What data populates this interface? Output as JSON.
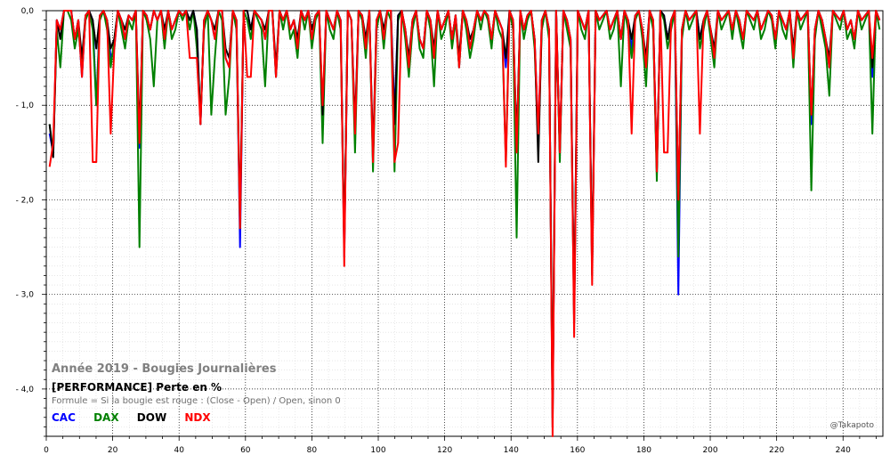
{
  "chart_data": {
    "type": "line",
    "title": "Année 2019 - Bougies Journalières",
    "subtitle": "[PERFORMANCE] Perte en %",
    "formula": "Formule = Si la bougie est rouge : (Close - Open) / Open, sinon 0",
    "credit": "@Takapoto",
    "xlim": [
      0,
      252
    ],
    "ylim": [
      -4.5,
      0
    ],
    "x_ticks": [
      "0",
      "20",
      "40",
      "60",
      "80",
      "100",
      "120",
      "140",
      "160",
      "180",
      "200",
      "220",
      "240"
    ],
    "y_ticks": [
      {
        "value": 0,
        "label": "0,0"
      },
      {
        "value": -1,
        "label": "- 1,0"
      },
      {
        "value": -2,
        "label": "- 2,0"
      },
      {
        "value": -3,
        "label": "- 3,0"
      },
      {
        "value": -4,
        "label": "- 4,0"
      }
    ],
    "grid": true,
    "legend_position": "bottom-left",
    "series": [
      {
        "name": "CAC",
        "color": "#0000ff",
        "values": [
          -1.3,
          -1.5,
          -0.1,
          -0.2,
          0,
          0,
          0,
          -0.3,
          -0.1,
          -0.7,
          -0.05,
          0,
          -0.1,
          -1.0,
          -0.05,
          0,
          -0.1,
          -0.5,
          -0.4,
          0,
          -0.1,
          -0.3,
          -0.05,
          -0.1,
          0,
          -1.45,
          0,
          -0.05,
          -0.2,
          0,
          -0.1,
          0,
          -0.3,
          0,
          -0.2,
          -0.1,
          0,
          -0.05,
          0,
          -0.1,
          0,
          -0.2,
          -1.2,
          -0.1,
          0,
          -0.1,
          -0.3,
          0,
          0,
          -0.5,
          -0.6,
          0,
          -0.1,
          -2.5,
          0,
          0,
          -0.2,
          0,
          -0.05,
          -0.1,
          -0.3,
          0,
          0,
          -0.7,
          0,
          -0.1,
          0,
          -0.2,
          -0.1,
          -0.4,
          0,
          -0.1,
          0,
          -0.3,
          -0.05,
          0,
          -1.1,
          0,
          -0.1,
          -0.2,
          0,
          -0.1,
          -2.6,
          0,
          -0.1,
          -1.3,
          0,
          -0.05,
          -0.4,
          0,
          -1.6,
          -0.1,
          0,
          -0.3,
          0,
          0,
          -1.1,
          -0.05,
          0,
          -0.2,
          -0.6,
          -0.1,
          0,
          -0.3,
          -0.4,
          0,
          -0.1,
          -0.5,
          0,
          -0.2,
          -0.1,
          0,
          -0.3,
          -0.05,
          -0.6,
          0,
          -0.1,
          -0.4,
          -0.2,
          0,
          -0.1,
          0,
          -0.05,
          -0.3,
          0,
          -0.1,
          -0.2,
          -0.6,
          0,
          -0.1,
          -1.5,
          0,
          -0.2,
          -0.05,
          0,
          -0.3,
          -1.3,
          -0.1,
          0,
          -0.2,
          -4.3,
          0,
          -1.5,
          0,
          -0.1,
          -0.3,
          -3.3,
          0,
          -0.1,
          -0.2,
          0,
          -2.8,
          0,
          -0.1,
          -0.05,
          0,
          -0.2,
          -0.1,
          0,
          -0.3,
          0,
          -0.1,
          -0.4,
          -0.05,
          0,
          -0.2,
          -0.6,
          0,
          -0.1,
          -1.7,
          0,
          -0.05,
          -0.3,
          -0.1,
          0,
          -3.0,
          -0.2,
          0,
          -0.1,
          -0.05,
          0,
          -0.3,
          -0.1,
          0,
          -0.2,
          -0.5,
          0,
          -0.1,
          -0.05,
          0,
          -0.2,
          0,
          -0.1,
          -0.3,
          0,
          -0.05,
          -0.1,
          0,
          -0.2,
          -0.1,
          0,
          -0.05,
          -0.3,
          0,
          -0.1,
          -0.2,
          0,
          -0.5,
          0,
          -0.1,
          -0.05,
          0,
          -1.2,
          -0.2,
          0,
          -0.1,
          -0.3,
          -0.6,
          0,
          -0.05,
          -0.1,
          0,
          -0.2,
          -0.1,
          -0.3,
          0,
          -0.1,
          -0.05,
          0,
          -0.7,
          0,
          -0.1
        ]
      },
      {
        "name": "DAX",
        "color": "#008000",
        "values": [
          -1.2,
          -1.5,
          -0.2,
          -0.6,
          0,
          0,
          -0.1,
          -0.4,
          -0.2,
          -0.6,
          -0.1,
          0,
          -0.2,
          -1.0,
          -0.1,
          0,
          -0.2,
          -0.6,
          -0.3,
          0,
          -0.2,
          -0.4,
          -0.1,
          -0.2,
          0,
          -2.5,
          0,
          -0.1,
          -0.3,
          -0.8,
          -0.1,
          0,
          -0.4,
          0,
          -0.3,
          -0.2,
          0,
          -0.1,
          0,
          -0.2,
          0,
          -0.4,
          -1.1,
          -0.2,
          0,
          -1.1,
          -0.5,
          0,
          -0.1,
          -1.1,
          -0.7,
          0,
          -0.2,
          -2.3,
          0,
          -0.1,
          -0.3,
          0,
          -0.1,
          -0.2,
          -0.8,
          0,
          0,
          -0.7,
          0,
          -0.2,
          0,
          -0.3,
          -0.2,
          -0.5,
          0,
          -0.2,
          0,
          -0.4,
          -0.1,
          0,
          -1.4,
          0,
          -0.2,
          -0.3,
          0,
          -0.2,
          -2.5,
          0,
          -0.1,
          -1.5,
          0,
          -0.1,
          -0.5,
          0,
          -1.7,
          -0.2,
          0,
          -0.4,
          0,
          -0.1,
          -1.7,
          -0.1,
          0,
          -0.3,
          -0.7,
          -0.2,
          0,
          -0.4,
          -0.5,
          0,
          -0.2,
          -0.8,
          0,
          -0.3,
          -0.2,
          0,
          -0.4,
          -0.1,
          -0.6,
          0,
          -0.2,
          -0.5,
          -0.3,
          0,
          -0.2,
          0,
          -0.1,
          -0.4,
          0,
          -0.2,
          -0.3,
          -1.6,
          0,
          -0.2,
          -2.4,
          0,
          -0.3,
          -0.1,
          0,
          -0.4,
          -1.4,
          -0.2,
          0,
          -0.3,
          -4.2,
          0,
          -1.6,
          0,
          -0.2,
          -0.4,
          -3.3,
          0,
          -0.2,
          -0.3,
          0,
          -2.8,
          0,
          -0.2,
          -0.1,
          0,
          -0.3,
          -0.2,
          0,
          -0.8,
          0,
          -0.2,
          -0.5,
          -0.1,
          0,
          -0.3,
          -0.8,
          0,
          -0.2,
          -1.8,
          0,
          -0.1,
          -0.4,
          -0.2,
          0,
          -2.6,
          -0.3,
          0,
          -0.2,
          -0.1,
          0,
          -0.4,
          -0.2,
          0,
          -0.3,
          -0.6,
          0,
          -0.2,
          -0.1,
          0,
          -0.3,
          0,
          -0.2,
          -0.4,
          0,
          -0.1,
          -0.2,
          0,
          -0.3,
          -0.2,
          0,
          -0.1,
          -0.4,
          0,
          -0.2,
          -0.3,
          0,
          -0.6,
          0,
          -0.2,
          -0.1,
          0,
          -1.9,
          -0.3,
          0,
          -0.2,
          -0.4,
          -0.9,
          0,
          -0.1,
          -0.2,
          0,
          -0.3,
          -0.2,
          -0.4,
          0,
          -0.2,
          -0.1,
          0,
          -1.3,
          0,
          -0.2
        ]
      },
      {
        "name": "DOW",
        "color": "#000000",
        "values": [
          -1.2,
          -1.55,
          -0.1,
          -0.3,
          0,
          0,
          0,
          -0.3,
          -0.1,
          -0.5,
          -0.05,
          0,
          -0.1,
          -0.4,
          -0.05,
          0,
          -0.1,
          -0.4,
          -0.3,
          0,
          -0.1,
          -0.2,
          -0.05,
          -0.1,
          0,
          -1.3,
          0,
          -0.05,
          -0.2,
          0,
          -0.1,
          0,
          -0.2,
          0,
          -0.2,
          -0.1,
          0,
          -0.05,
          0,
          -0.1,
          0,
          -0.2,
          -1.2,
          -0.1,
          0,
          -0.1,
          -0.2,
          0,
          0,
          -0.4,
          -0.5,
          0,
          -0.1,
          -2.2,
          0,
          0,
          -0.2,
          0,
          -0.05,
          -0.1,
          -0.2,
          0,
          0,
          -0.6,
          0,
          -0.1,
          0,
          -0.2,
          -0.1,
          -0.3,
          0,
          -0.1,
          0,
          -0.2,
          -0.05,
          0,
          -1.1,
          0,
          -0.1,
          -0.2,
          0,
          -0.1,
          -2.5,
          0,
          -0.1,
          -1.2,
          0,
          -0.05,
          -0.3,
          0,
          -1.5,
          -0.1,
          0,
          -0.2,
          0,
          0,
          -1.2,
          -0.05,
          0,
          -0.2,
          -0.5,
          -0.1,
          0,
          -0.3,
          -0.4,
          0,
          -0.1,
          -0.4,
          0,
          -0.2,
          -0.1,
          0,
          -0.3,
          -0.05,
          -0.5,
          0,
          -0.1,
          -0.3,
          -0.2,
          0,
          -0.1,
          0,
          -0.05,
          -0.3,
          0,
          -0.1,
          -0.2,
          -0.5,
          0,
          -0.1,
          -1.4,
          0,
          -0.2,
          -0.05,
          0,
          -0.3,
          -1.6,
          -0.1,
          0,
          -0.2,
          -4.4,
          0,
          -1.5,
          0,
          -0.1,
          -0.3,
          -3.2,
          0,
          -0.1,
          -0.2,
          0,
          -2.7,
          0,
          -0.1,
          -0.05,
          0,
          -0.2,
          -0.1,
          0,
          -0.3,
          0,
          -0.1,
          -0.3,
          -0.05,
          0,
          -0.2,
          -0.5,
          0,
          -0.1,
          -1.7,
          0,
          -0.05,
          -0.3,
          -0.1,
          0,
          -2.0,
          -0.2,
          0,
          -0.1,
          -0.05,
          0,
          -0.3,
          -0.1,
          0,
          -0.2,
          -0.4,
          0,
          -0.1,
          -0.05,
          0,
          -0.2,
          0,
          -0.1,
          -0.3,
          0,
          -0.05,
          -0.1,
          0,
          -0.2,
          -0.1,
          0,
          -0.05,
          -0.3,
          0,
          -0.1,
          -0.2,
          0,
          -0.4,
          0,
          -0.1,
          -0.05,
          0,
          -1.1,
          -0.2,
          0,
          -0.1,
          -0.3,
          -0.5,
          0,
          -0.05,
          -0.1,
          0,
          -0.2,
          -0.1,
          -0.3,
          0,
          -0.1,
          -0.05,
          0,
          -0.6,
          0,
          -0.1
        ]
      },
      {
        "name": "NDX",
        "color": "#ff0000",
        "values": [
          -1.65,
          -1.4,
          -0.1,
          -0.2,
          0,
          0,
          0,
          -0.3,
          -0.1,
          -0.7,
          -0.05,
          0,
          -1.6,
          -1.6,
          -0.05,
          0,
          -0.1,
          -1.3,
          -0.4,
          0,
          -0.1,
          -0.3,
          -0.05,
          -0.1,
          0,
          -1.4,
          0,
          -0.05,
          -0.2,
          0,
          -0.1,
          0,
          -0.3,
          0,
          -0.2,
          -0.1,
          0,
          -0.05,
          0,
          -0.5,
          -0.5,
          -0.5,
          -1.2,
          -0.1,
          0,
          -0.1,
          -0.3,
          0,
          0,
          -0.5,
          -0.6,
          0,
          -0.1,
          -2.3,
          0,
          -0.7,
          -0.7,
          0,
          -0.05,
          -0.1,
          -0.3,
          0,
          0,
          -0.7,
          0,
          -0.1,
          0,
          -0.2,
          -0.1,
          -0.4,
          0,
          -0.1,
          0,
          -0.3,
          -0.05,
          0,
          -1.0,
          0,
          -0.1,
          -0.2,
          0,
          -0.1,
          -2.7,
          0,
          -0.1,
          -1.3,
          0,
          -0.05,
          -0.4,
          0,
          -1.6,
          -0.1,
          0,
          -0.3,
          0,
          0,
          -1.6,
          -1.4,
          0,
          -0.2,
          -0.6,
          -0.1,
          0,
          -0.3,
          -0.4,
          0,
          -0.1,
          -0.5,
          0,
          -0.2,
          -0.1,
          0,
          -0.3,
          -0.05,
          -0.6,
          0,
          -0.1,
          -0.4,
          -0.2,
          0,
          -0.1,
          0,
          -0.05,
          -0.3,
          0,
          -0.1,
          -0.2,
          -1.65,
          0,
          -0.1,
          -1.5,
          0,
          -0.2,
          -0.05,
          0,
          -0.3,
          -1.3,
          -0.1,
          0,
          -0.2,
          -4.5,
          0,
          -1.5,
          0,
          -0.1,
          -0.3,
          -3.45,
          0,
          -0.1,
          -0.2,
          0,
          -2.9,
          0,
          -0.1,
          -0.05,
          0,
          -0.2,
          -0.1,
          0,
          -0.3,
          0,
          -0.1,
          -1.3,
          -0.05,
          0,
          -0.2,
          -0.6,
          0,
          -0.1,
          -1.7,
          0,
          -1.5,
          -1.5,
          -0.1,
          0,
          -2.0,
          -0.2,
          0,
          -0.1,
          -0.05,
          0,
          -1.3,
          -0.1,
          0,
          -0.2,
          -0.5,
          0,
          -0.1,
          -0.05,
          0,
          -0.2,
          0,
          -0.1,
          -0.3,
          0,
          -0.05,
          -0.1,
          0,
          -0.2,
          -0.1,
          0,
          -0.05,
          -0.3,
          0,
          -0.1,
          -0.2,
          0,
          -0.5,
          0,
          -0.1,
          -0.05,
          0,
          -1.1,
          -0.2,
          0,
          -0.1,
          -0.3,
          -0.6,
          0,
          -0.05,
          -0.1,
          0,
          -0.2,
          -0.1,
          -0.3,
          0,
          -0.1,
          -0.05,
          0,
          -0.5,
          0,
          -0.1
        ]
      }
    ]
  }
}
